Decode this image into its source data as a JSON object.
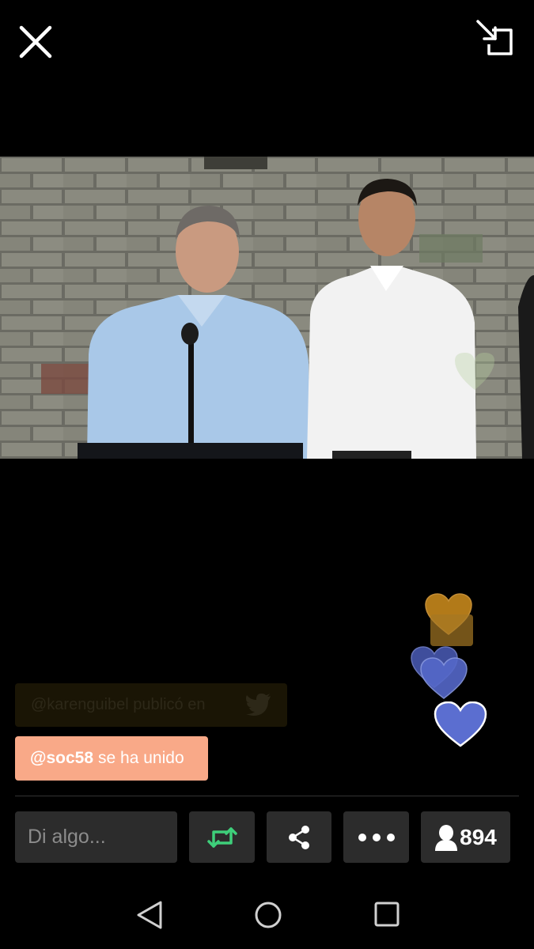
{
  "top_bar": {
    "close_icon": "close-icon",
    "minimize_icon": "picture-in-picture-icon"
  },
  "broadcast": {
    "content": "live-video-frame"
  },
  "chat": {
    "faded_comment": "@karenguibel publicó en",
    "faded_comment_icon": "twitter-bird-icon",
    "join_user": "@soc58",
    "join_text": "se ha unido",
    "join_color": "#f9a988"
  },
  "hearts": [
    {
      "color": "#d2901e"
    },
    {
      "color": "#a57824"
    },
    {
      "color": "#4a5cb8"
    },
    {
      "color": "#5568c9"
    },
    {
      "color": "#5b6ed0"
    }
  ],
  "bottom_bar": {
    "input_placeholder": "Di algo...",
    "retweet_icon": "retweet-icon",
    "retweet_color": "#3ecf7a",
    "share_icon": "share-icon",
    "more_icon": "more-icon",
    "viewers_icon": "person-icon",
    "viewer_count": "894"
  },
  "nav": {
    "back": "back-icon",
    "home": "home-icon",
    "recents": "recents-icon"
  }
}
